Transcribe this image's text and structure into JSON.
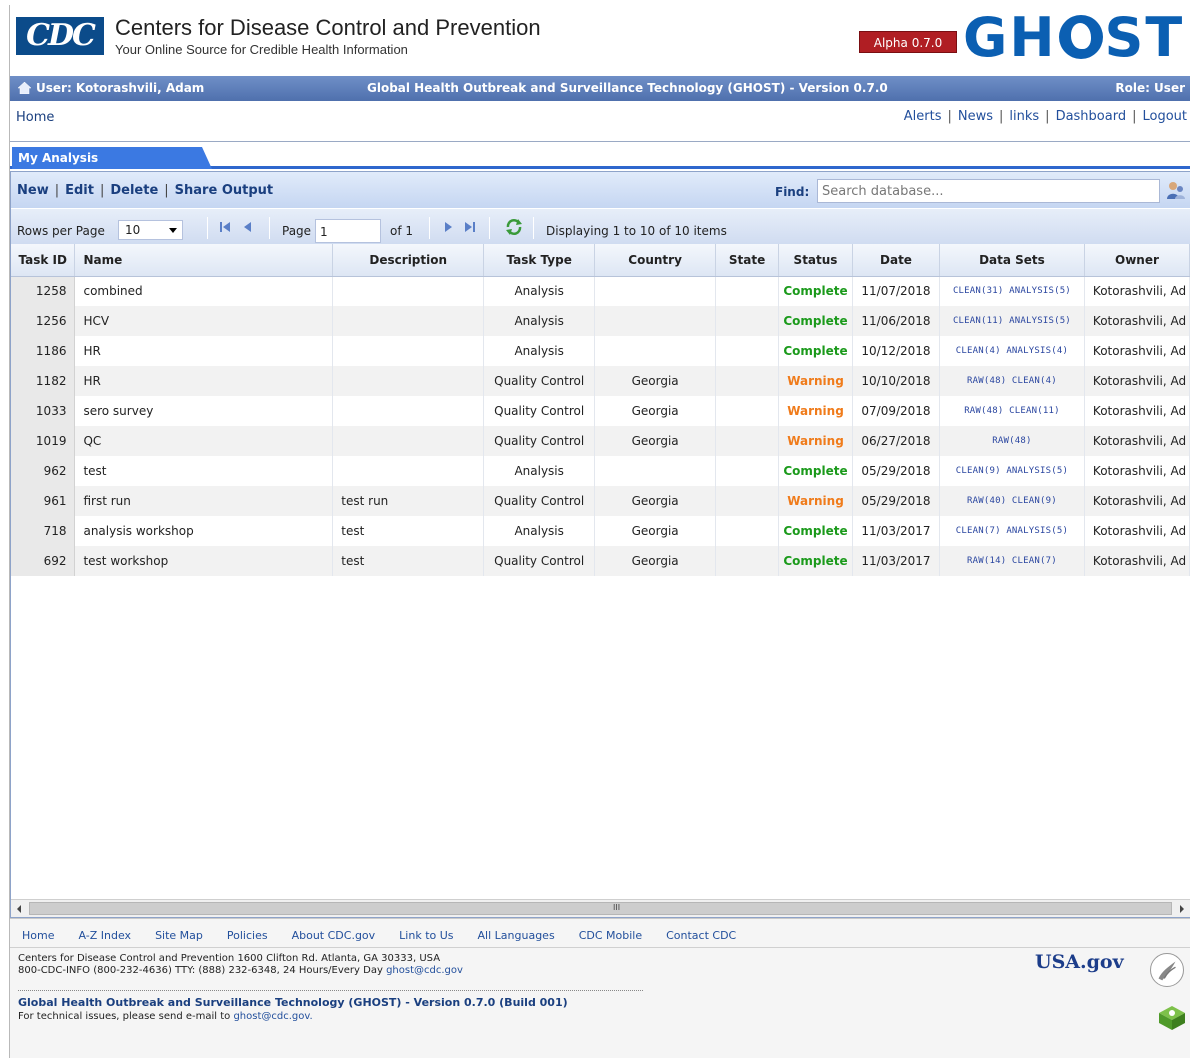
{
  "header": {
    "org_logo": "CDC",
    "org_title": "Centers for Disease Control and Prevention",
    "tagline": "Your Online Source for Credible Health Information",
    "version_badge": "Alpha 0.7.0",
    "app_logo_left": "GH",
    "app_logo_right": "ST",
    "brand_color": "#0b5fb2"
  },
  "user_bar": {
    "user": "User: Kotorashvili, Adam",
    "app_title": "Global Health Outbreak and Surveillance Technology (GHOST) - Version 0.7.0",
    "role": "Role: User"
  },
  "nav": {
    "home": "Home",
    "links": [
      "Alerts",
      "News",
      "links",
      "Dashboard",
      "Logout"
    ]
  },
  "tab": {
    "label": "My Analysis"
  },
  "toolbar": {
    "actions": [
      "New",
      "Edit",
      "Delete",
      "Share Output"
    ],
    "find_label": "Find:",
    "search_placeholder": "Search database..."
  },
  "pager": {
    "rows_label": "Rows per Page",
    "rows_value": "10",
    "page_label": "Page",
    "page_value": "1",
    "of_label": "of 1",
    "displaying": "Displaying 1 to 10 of 10 items"
  },
  "grid": {
    "columns": [
      "Task ID",
      "Name",
      "Description",
      "Task Type",
      "Country",
      "State",
      "Status",
      "Date",
      "Data Sets",
      "Owner"
    ],
    "rows": [
      {
        "id": "1258",
        "name": "combined",
        "description": "",
        "type": "Analysis",
        "country": "",
        "state": "",
        "status": "Complete",
        "date": "11/07/2018",
        "datasets": "CLEAN(31) ANALYSIS(5)",
        "owner": "Kotorashvili, Ad"
      },
      {
        "id": "1256",
        "name": "HCV",
        "description": "",
        "type": "Analysis",
        "country": "",
        "state": "",
        "status": "Complete",
        "date": "11/06/2018",
        "datasets": "CLEAN(11) ANALYSIS(5)",
        "owner": "Kotorashvili, Ad"
      },
      {
        "id": "1186",
        "name": "HR",
        "description": "",
        "type": "Analysis",
        "country": "",
        "state": "",
        "status": "Complete",
        "date": "10/12/2018",
        "datasets": "CLEAN(4) ANALYSIS(4)",
        "owner": "Kotorashvili, Ad"
      },
      {
        "id": "1182",
        "name": "HR",
        "description": "",
        "type": "Quality Control",
        "country": "Georgia",
        "state": "",
        "status": "Warning",
        "date": "10/10/2018",
        "datasets": "RAW(48) CLEAN(4)",
        "owner": "Kotorashvili, Ad"
      },
      {
        "id": "1033",
        "name": "sero survey",
        "description": "",
        "type": "Quality Control",
        "country": "Georgia",
        "state": "",
        "status": "Warning",
        "date": "07/09/2018",
        "datasets": "RAW(48) CLEAN(11)",
        "owner": "Kotorashvili, Ad"
      },
      {
        "id": "1019",
        "name": "QC",
        "description": "",
        "type": "Quality Control",
        "country": "Georgia",
        "state": "",
        "status": "Warning",
        "date": "06/27/2018",
        "datasets": "RAW(48)",
        "owner": "Kotorashvili, Ad"
      },
      {
        "id": "962",
        "name": "test",
        "description": "",
        "type": "Analysis",
        "country": "",
        "state": "",
        "status": "Complete",
        "date": "05/29/2018",
        "datasets": "CLEAN(9) ANALYSIS(5)",
        "owner": "Kotorashvili, Ad"
      },
      {
        "id": "961",
        "name": "first run",
        "description": "test run",
        "type": "Quality Control",
        "country": "Georgia",
        "state": "",
        "status": "Warning",
        "date": "05/29/2018",
        "datasets": "RAW(40) CLEAN(9)",
        "owner": "Kotorashvili, Ad"
      },
      {
        "id": "718",
        "name": "analysis workshop",
        "description": "test",
        "type": "Analysis",
        "country": "Georgia",
        "state": "",
        "status": "Complete",
        "date": "11/03/2017",
        "datasets": "CLEAN(7) ANALYSIS(5)",
        "owner": "Kotorashvili, Ad"
      },
      {
        "id": "692",
        "name": "test workshop",
        "description": "test",
        "type": "Quality Control",
        "country": "Georgia",
        "state": "",
        "status": "Complete",
        "date": "11/03/2017",
        "datasets": "RAW(14) CLEAN(7)",
        "owner": "Kotorashvili, Ad"
      }
    ],
    "status_colors": {
      "Complete": "#1b9a1b",
      "Warning": "#f07b1a"
    }
  },
  "footer": {
    "links": [
      "Home",
      "A-Z Index",
      "Site Map",
      "Policies",
      "About CDC.gov",
      "Link to Us",
      "All Languages",
      "CDC Mobile",
      "Contact CDC"
    ],
    "address_line1": "Centers for Disease Control and Prevention 1600 Clifton Rd. Atlanta, GA 30333, USA",
    "address_line2": "800-CDC-INFO (800-232-4636) TTY: (888) 232-6348, 24 Hours/Every Day",
    "email": "ghost@cdc.gov",
    "app_build": "Global Health Outbreak and Surveillance Technology (GHOST) - Version 0.7.0 (Build 001)",
    "support_text": "For technical issues, please send e-mail to",
    "support_email": "ghost@cdc.gov.",
    "usagov": "USA.gov"
  }
}
